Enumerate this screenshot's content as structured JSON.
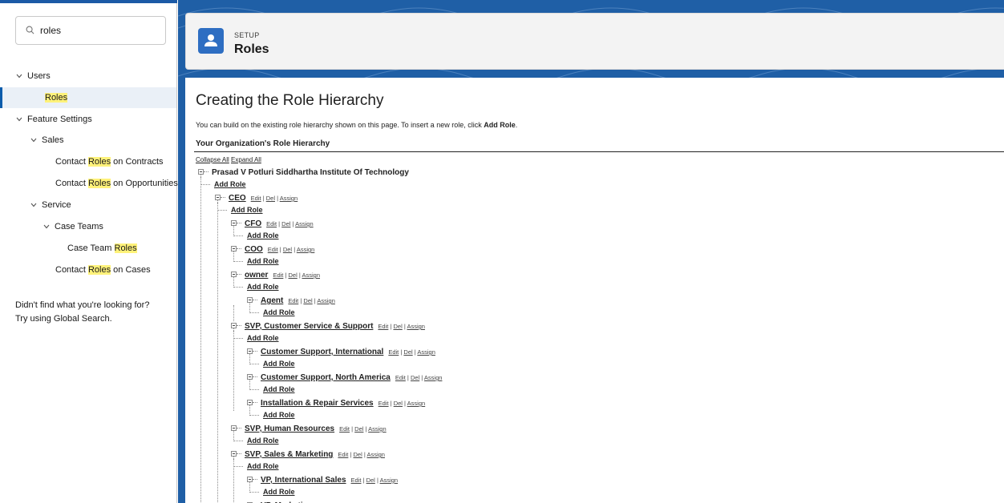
{
  "search": {
    "value": "roles"
  },
  "sidebar": {
    "users": {
      "label": "Users"
    },
    "roles": {
      "label": "Roles"
    },
    "feature_settings": {
      "label": "Feature Settings"
    },
    "sales": {
      "label": "Sales"
    },
    "contact_roles_contracts": {
      "pre": "Contact ",
      "hl": "Roles",
      "post": " on Contracts"
    },
    "contact_roles_opps": {
      "pre": "Contact ",
      "hl": "Roles",
      "post": " on Opportunities"
    },
    "service": {
      "label": "Service"
    },
    "case_teams": {
      "label": "Case Teams"
    },
    "case_team_roles": {
      "pre": "Case Team ",
      "hl": "Roles"
    },
    "contact_roles_cases": {
      "pre": "Contact ",
      "hl": "Roles",
      "post": " on Cases"
    },
    "help_line1": "Didn't find what you're looking for?",
    "help_line2": "Try using Global Search."
  },
  "header": {
    "setup": "SETUP",
    "title": "Roles"
  },
  "content": {
    "title": "Creating the Role Hierarchy",
    "desc_pre": "You can build on the existing role hierarchy shown on this page. To insert a new role, click ",
    "desc_bold": "Add Role",
    "desc_post": ".",
    "hierarchy_header": "Your Organization's Role Hierarchy",
    "collapse_all": "Collapse All",
    "expand_all": "Expand All",
    "root": "Prasad V Potluri Siddhartha Institute Of Technology",
    "add_role": "Add Role",
    "edit": "Edit",
    "del": "Del",
    "assign": "Assign",
    "sep": "|"
  },
  "roles": [
    {
      "name": "CEO"
    },
    {
      "name": "CFO"
    },
    {
      "name": "COO"
    },
    {
      "name": "owner"
    },
    {
      "name": "Agent"
    },
    {
      "name": "SVP, Customer Service & Support"
    },
    {
      "name": "Customer Support, International"
    },
    {
      "name": "Customer Support, North America"
    },
    {
      "name": "Installation & Repair Services"
    },
    {
      "name": "SVP, Human Resources"
    },
    {
      "name": "SVP, Sales & Marketing"
    },
    {
      "name": "VP, International Sales"
    },
    {
      "name": "VP, Marketing"
    }
  ],
  "colors": {
    "accent": "#0b5cab",
    "header_bg": "#1f5fa6",
    "highlight": "#fff27a"
  }
}
